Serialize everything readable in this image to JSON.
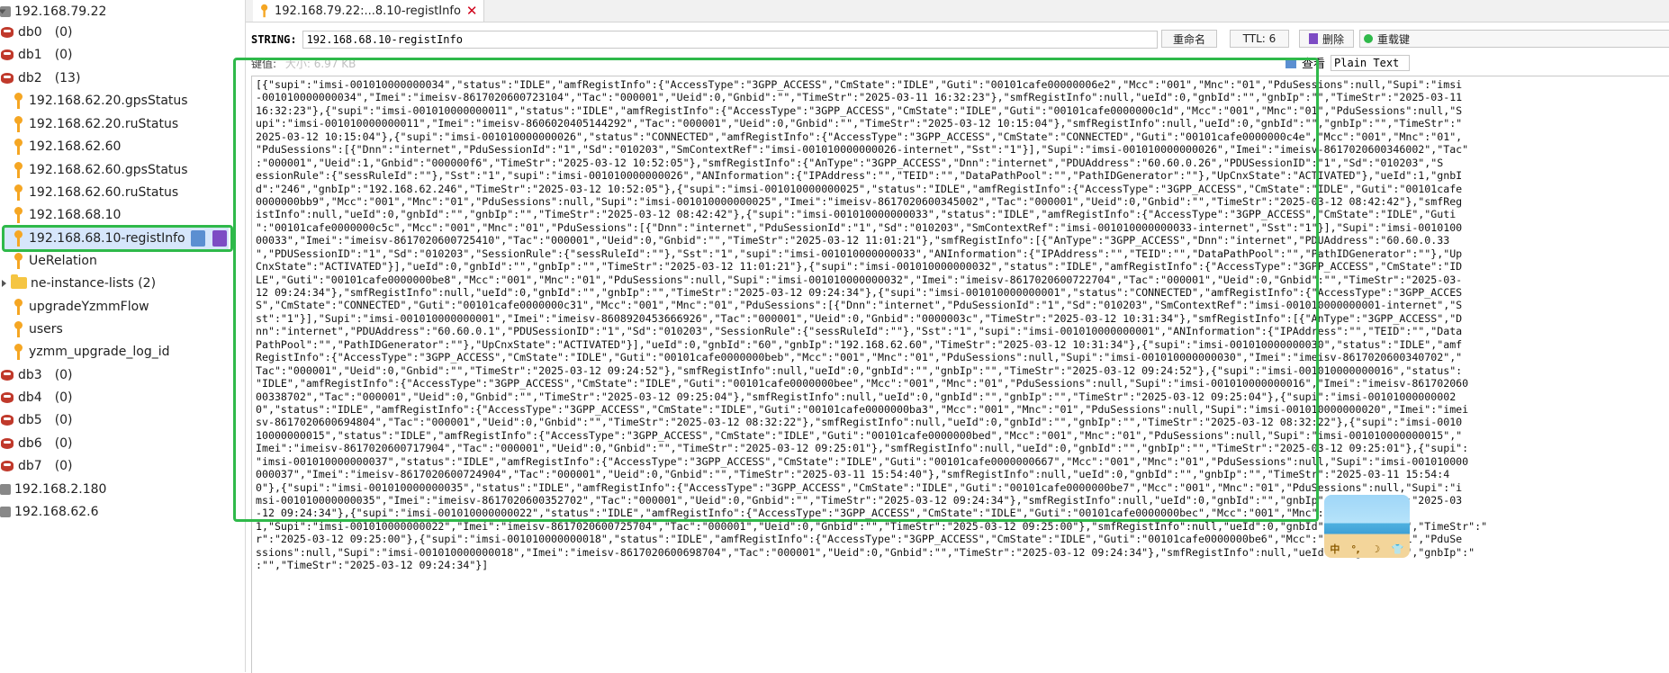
{
  "tree": {
    "servers": [
      {
        "label": "192.168.79.22"
      },
      {
        "label": "192.168.2.180"
      },
      {
        "label": "192.168.62.6"
      }
    ],
    "databases": [
      {
        "label": "db0",
        "count": "(0)"
      },
      {
        "label": "db1",
        "count": "(0)"
      },
      {
        "label": "db2",
        "count": "(13)"
      },
      {
        "label": "db3",
        "count": "(0)"
      },
      {
        "label": "db4",
        "count": "(0)"
      },
      {
        "label": "db5",
        "count": "(0)"
      },
      {
        "label": "db6",
        "count": "(0)"
      },
      {
        "label": "db7",
        "count": "(0)"
      }
    ],
    "keys": [
      {
        "label": "192.168.62.20.gpsStatus"
      },
      {
        "label": "192.168.62.20.ruStatus"
      },
      {
        "label": "192.168.62.60"
      },
      {
        "label": "192.168.62.60.gpsStatus"
      },
      {
        "label": "192.168.62.60.ruStatus"
      },
      {
        "label": "192.168.68.10"
      },
      {
        "label": "192.168.68.10-registInfo"
      },
      {
        "label": "UeRelation"
      },
      {
        "label": "ne-instance-lists (2)"
      },
      {
        "label": "upgradeYzmmFlow"
      },
      {
        "label": "users"
      },
      {
        "label": "yzmm_upgrade_log_id"
      }
    ]
  },
  "tab": {
    "title": "192.168.79.22:...8.10-registInfo",
    "close": "✕"
  },
  "key_bar": {
    "type": "STRING:",
    "name": "192.168.68.10-registInfo",
    "rename": "重命名",
    "ttl": "TTL: 6",
    "delete": "删除",
    "reload": "重载键"
  },
  "value_meta": {
    "label": "键值:",
    "size": "大小: 6.97 KB"
  },
  "view": {
    "label": "查看",
    "mode": "Plain Text"
  },
  "tray": {
    "items": [
      "中",
      "°,",
      "☽",
      "👕"
    ]
  },
  "value_lines": [
    "[{\"supi\":\"imsi-001010000000034\",\"status\":\"IDLE\",\"amfRegistInfo\":{\"AccessType\":\"3GPP_ACCESS\",\"CmState\":\"IDLE\",\"Guti\":\"00101cafe00000006e2\",\"Mcc\":\"001\",\"Mnc\":\"01\",\"PduSessions\":null,\"Supi\":\"imsi",
    "-001010000000034\",\"Imei\":\"imeisv-8617020600723104\",\"Tac\":\"000001\",\"Ueid\":0,\"Gnbid\":\"\",\"TimeStr\":\"2025-03-11 16:32:23\"},\"smfRegistInfo\":null,\"ueId\":0,\"gnbId\":\"\",\"gnbIp\":\"\",\"TimeStr\":\"2025-03-11",
    "16:32:23\"},{\"supi\":\"imsi-001010000000011\",\"status\":\"IDLE\",\"amfRegistInfo\":{\"AccessType\":\"3GPP_ACCESS\",\"CmState\":\"IDLE\",\"Guti\":\"00101cafe0000000c1d\",\"Mcc\":\"001\",\"Mnc\":\"01\",\"PduSessions\":null,\"S",
    "upi\":\"imsi-001010000000011\",\"Imei\":\"imeisv-8606020405144292\",\"Tac\":\"000001\",\"Ueid\":0,\"Gnbid\":\"\",\"TimeStr\":\"2025-03-12 10:15:04\"},\"smfRegistInfo\":null,\"ueId\":0,\"gnbId\":\"\",\"gnbIp\":\"\",\"TimeStr\":\"",
    "2025-03-12 10:15:04\"},{\"supi\":\"imsi-001010000000026\",\"status\":\"CONNECTED\",\"amfRegistInfo\":{\"AccessType\":\"3GPP_ACCESS\",\"CmState\":\"CONNECTED\",\"Guti\":\"00101cafe0000000c4e\",\"Mcc\":\"001\",\"Mnc\":\"01\",",
    "\"PduSessions\":[{\"Dnn\":\"internet\",\"PduSessionId\":\"1\",\"Sd\":\"010203\",\"SmContextRef\":\"imsi-001010000000026-internet\",\"Sst\":\"1\"}],\"Supi\":\"imsi-001010000000026\",\"Imei\":\"imeisv-8617020600346002\",\"Tac\"",
    ":\"000001\",\"Ueid\":1,\"Gnbid\":\"000000f6\",\"TimeStr\":\"2025-03-12 10:52:05\"},\"smfRegistInfo\":{\"AnType\":\"3GPP_ACCESS\",\"Dnn\":\"internet\",\"PDUAddress\":\"60.60.0.26\",\"PDUSessionID\":\"1\",\"Sd\":\"010203\",\"S",
    "essionRule\":{\"sessRuleId\":\"\"},\"Sst\":\"1\",\"supi\":\"imsi-001010000000026\",\"ANInformation\":{\"IPAddress\":\"\",\"TEID\":\"\",\"DataPathPool\":\"\",\"PathIDGenerator\":\"\"},\"UpCnxState\":\"ACTIVATED\"},\"ueId\":1,\"gnbI",
    "d\":\"246\",\"gnbIp\":\"192.168.62.246\",\"TimeStr\":\"2025-03-12 10:52:05\"},{\"supi\":\"imsi-001010000000025\",\"status\":\"IDLE\",\"amfRegistInfo\":{\"AccessType\":\"3GPP_ACCESS\",\"CmState\":\"IDLE\",\"Guti\":\"00101cafe",
    "0000000bb9\",\"Mcc\":\"001\",\"Mnc\":\"01\",\"PduSessions\":null,\"Supi\":\"imsi-001010000000025\",\"Imei\":\"imeisv-8617020600345002\",\"Tac\":\"000001\",\"Ueid\":0,\"Gnbid\":\"\",\"TimeStr\":\"2025-03-12 08:42:42\"},\"smfReg",
    "istInfo\":null,\"ueId\":0,\"gnbId\":\"\",\"gnbIp\":\"\",\"TimeStr\":\"2025-03-12 08:42:42\"},{\"supi\":\"imsi-001010000000033\",\"status\":\"IDLE\",\"amfRegistInfo\":{\"AccessType\":\"3GPP_ACCESS\",\"CmState\":\"IDLE\",\"Guti",
    "\":\"00101cafe0000000c5c\",\"Mcc\":\"001\",\"Mnc\":\"01\",\"PduSessions\":[{\"Dnn\":\"internet\",\"PduSessionId\":\"1\",\"Sd\":\"010203\",\"SmContextRef\":\"imsi-001010000000033-internet\",\"Sst\":\"1\"}],\"Supi\":\"imsi-0010100",
    "00033\",\"Imei\":\"imeisv-8617020600725410\",\"Tac\":\"000001\",\"Ueid\":0,\"Gnbid\":\"\",\"TimeStr\":\"2025-03-12 11:01:21\"},\"smfRegistInfo\":[{\"AnType\":\"3GPP_ACCESS\",\"Dnn\":\"internet\",\"PDUAddress\":\"60.60.0.33",
    "\",\"PDUSessionID\":\"1\",\"Sd\":\"010203\",\"SessionRule\":{\"sessRuleId\":\"\"},\"Sst\":\"1\",\"supi\":\"imsi-001010000000033\",\"ANInformation\":{\"IPAddress\":\"\",\"TEID\":\"\",\"DataPathPool\":\"\",\"PathIDGenerator\":\"\"},\"Up",
    "CnxState\":\"ACTIVATED\"}],\"ueId\":0,\"gnbId\":\"\",\"gnbIp\":\"\",\"TimeStr\":\"2025-03-12 11:01:21\"},{\"supi\":\"imsi-001010000000032\",\"status\":\"IDLE\",\"amfRegistInfo\":{\"AccessType\":\"3GPP_ACCESS\",\"CmState\":\"ID",
    "LE\",\"Guti\":\"00101cafe0000000be8\",\"Mcc\":\"001\",\"Mnc\":\"01\",\"PduSessions\":null,\"Supi\":\"imsi-001010000000032\",\"Imei\":\"imeisv-8617020600722704\",\"Tac\":\"000001\",\"Ueid\":0,\"Gnbid\":\"\",\"TimeStr\":\"2025-03-",
    "12 09:24:34\"},\"smfRegistInfo\":null,\"ueId\":0,\"gnbId\":\"\",\"gnbIp\":\"\",\"TimeStr\":\"2025-03-12 09:24:34\"},{\"supi\":\"imsi-001010000000001\",\"status\":\"CONNECTED\",\"amfRegistInfo\":{\"AccessType\":\"3GPP_ACCES",
    "S\",\"CmState\":\"CONNECTED\",\"Guti\":\"00101cafe0000000c31\",\"Mcc\":\"001\",\"Mnc\":\"01\",\"PduSessions\":[{\"Dnn\":\"internet\",\"PduSessionId\":\"1\",\"Sd\":\"010203\",\"SmContextRef\":\"imsi-001010000000001-internet\",\"S",
    "st\":\"1\"}],\"Supi\":\"imsi-001010000000001\",\"Imei\":\"imeisv-8608920453666926\",\"Tac\":\"000001\",\"Ueid\":0,\"Gnbid\":\"0000003c\",\"TimeStr\":\"2025-03-12 10:31:34\"},\"smfRegistInfo\":[{\"AnType\":\"3GPP_ACCESS\",\"D",
    "nn\":\"internet\",\"PDUAddress\":\"60.60.0.1\",\"PDUSessionID\":\"1\",\"Sd\":\"010203\",\"SessionRule\":{\"sessRuleId\":\"\"},\"Sst\":\"1\",\"supi\":\"imsi-001010000000001\",\"ANInformation\":{\"IPAddress\":\"\",\"TEID\":\"\",\"Data",
    "PathPool\":\"\",\"PathIDGenerator\":\"\"},\"UpCnxState\":\"ACTIVATED\"}],\"ueId\":0,\"gnbId\":\"60\",\"gnbIp\":\"192.168.62.60\",\"TimeStr\":\"2025-03-12 10:31:34\"},{\"supi\":\"imsi-001010000000030\",\"status\":\"IDLE\",\"amf",
    "RegistInfo\":{\"AccessType\":\"3GPP_ACCESS\",\"CmState\":\"IDLE\",\"Guti\":\"00101cafe0000000beb\",\"Mcc\":\"001\",\"Mnc\":\"01\",\"PduSessions\":null,\"Supi\":\"imsi-001010000000030\",\"Imei\":\"imeisv-8617020600340702\",\"",
    "Tac\":\"000001\",\"Ueid\":0,\"Gnbid\":\"\",\"TimeStr\":\"2025-03-12 09:24:52\"},\"smfRegistInfo\":null,\"ueId\":0,\"gnbId\":\"\",\"gnbIp\":\"\",\"TimeStr\":\"2025-03-12 09:24:52\"},{\"supi\":\"imsi-001010000000016\",\"status\":",
    "\"IDLE\",\"amfRegistInfo\":{\"AccessType\":\"3GPP_ACCESS\",\"CmState\":\"IDLE\",\"Guti\":\"00101cafe0000000bee\",\"Mcc\":\"001\",\"Mnc\":\"01\",\"PduSessions\":null,\"Supi\":\"imsi-001010000000016\",\"Imei\":\"imeisv-861702060",
    "00338702\",\"Tac\":\"000001\",\"Ueid\":0,\"Gnbid\":\"\",\"TimeStr\":\"2025-03-12 09:25:04\"},\"smfRegistInfo\":null,\"ueId\":0,\"gnbId\":\"\",\"gnbIp\":\"\",\"TimeStr\":\"2025-03-12 09:25:04\"},{\"supi\":\"imsi-00101000000002",
    "0\",\"status\":\"IDLE\",\"amfRegistInfo\":{\"AccessType\":\"3GPP_ACCESS\",\"CmState\":\"IDLE\",\"Guti\":\"00101cafe0000000ba3\",\"Mcc\":\"001\",\"Mnc\":\"01\",\"PduSessions\":null,\"Supi\":\"imsi-001010000000020\",\"Imei\":\"imei",
    "sv-8617020600694804\",\"Tac\":\"000001\",\"Ueid\":0,\"Gnbid\":\"\",\"TimeStr\":\"2025-03-12 08:32:22\"},\"smfRegistInfo\":null,\"ueId\":0,\"gnbId\":\"\",\"gnbIp\":\"\",\"TimeStr\":\"2025-03-12 08:32:22\"},{\"supi\":\"imsi-0010",
    "10000000015\",\"status\":\"IDLE\",\"amfRegistInfo\":{\"AccessType\":\"3GPP_ACCESS\",\"CmState\":\"IDLE\",\"Guti\":\"00101cafe0000000bed\",\"Mcc\":\"001\",\"Mnc\":\"01\",\"PduSessions\":null,\"Supi\":\"imsi-001010000000015\",\"",
    "Imei\":\"imeisv-8617020600717904\",\"Tac\":\"000001\",\"Ueid\":0,\"Gnbid\":\"\",\"TimeStr\":\"2025-03-12 09:25:01\"},\"smfRegistInfo\":null,\"ueId\":0,\"gnbId\":\"\",\"gnbIp\":\"\",\"TimeStr\":\"2025-03-12 09:25:01\"},{\"supi\":",
    "\"imsi-001010000000037\",\"status\":\"IDLE\",\"amfRegistInfo\":{\"AccessType\":\"3GPP_ACCESS\",\"CmState\":\"IDLE\",\"Guti\":\"00101cafe0000000667\",\"Mcc\":\"001\",\"Mnc\":\"01\",\"PduSessions\":null,\"Supi\":\"imsi-001010000",
    "000037\",\"Imei\":\"imeisv-8617020600724904\",\"Tac\":\"000001\",\"Ueid\":0,\"Gnbid\":\"\",\"TimeStr\":\"2025-03-11 15:54:40\"},\"smfRegistInfo\":null,\"ueId\":0,\"gnbId\":\"\",\"gnbIp\":\"\",\"TimeStr\":\"2025-03-11 15:54:4",
    "0\"},{\"supi\":\"imsi-001010000000035\",\"status\":\"IDLE\",\"amfRegistInfo\":{\"AccessType\":\"3GPP_ACCESS\",\"CmState\":\"IDLE\",\"Guti\":\"00101cafe0000000be7\",\"Mcc\":\"001\",\"Mnc\":\"01\",\"PduSessions\":null,\"Supi\":\"i",
    "msi-001010000000035\",\"Imei\":\"imeisv-8617020600352702\",\"Tac\":\"000001\",\"Ueid\":0,\"Gnbid\":\"\",\"TimeStr\":\"2025-03-12 09:24:34\"},\"smfRegistInfo\":null,\"ueId\":0,\"gnbId\":\"\",\"gnbIp\":\"\",\"TimeStr\":\"2025-03",
    "-12 09:24:34\"},{\"supi\":\"imsi-001010000000022\",\"status\":\"IDLE\",\"amfRegistInfo\":{\"AccessType\":\"3GPP_ACCESS\",\"CmState\":\"IDLE\",\"Guti\":\"00101cafe0000000bec\",\"Mcc\":\"001\",\"Mnc\":\"01\",",
    "1,\"Supi\":\"imsi-001010000000022\",\"Imei\":\"imeisv-8617020600725704\",\"Tac\":\"000001\",\"Ueid\":0,\"Gnbid\":\"\",\"TimeStr\":\"2025-03-12 09:25:00\"},\"smfRegistInfo\":null,\"ueId\":0,\"gnbId\":\"\",\"gnbIp\":\"\",\"TimeStr\":\"",
    "r\":\"2025-03-12 09:25:00\"},{\"supi\":\"imsi-001010000000018\",\"status\":\"IDLE\",\"amfRegistInfo\":{\"AccessType\":\"3GPP_ACCESS\",\"CmState\":\"IDLE\",\"Guti\":\"00101cafe0000000be6\",\"Mcc\":\"001\",\"Mnc\":\"01\",\"PduSe",
    "ssions\":null,\"Supi\":\"imsi-001010000000018\",\"Imei\":\"imeisv-8617020600698704\",\"Tac\":\"000001\",\"Ueid\":0,\"Gnbid\":\"\",\"TimeStr\":\"2025-03-12 09:24:34\"},\"smfRegistInfo\":null,\"ueId\":0,\"gnbId\":\"\",\"gnbIp\":\"",
    ":\"\",\"TimeStr\":\"2025-03-12 09:24:34\"}]"
  ]
}
